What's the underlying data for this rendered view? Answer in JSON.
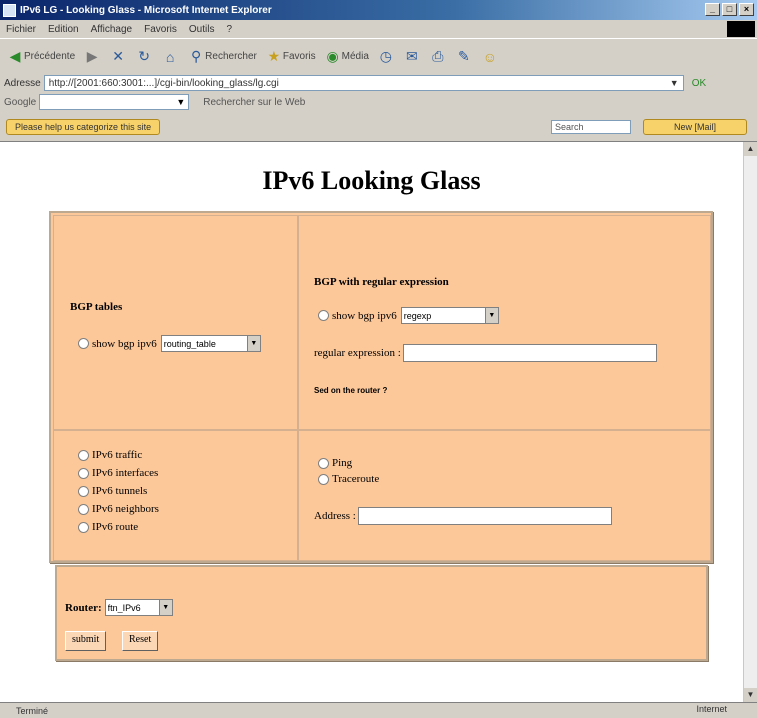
{
  "window": {
    "title": "IPv6 LG - Looking Glass - Microsoft Internet Explorer",
    "controls": [
      "_",
      "□",
      "×"
    ]
  },
  "menubar": {
    "items": [
      "Fichier",
      "Edition",
      "Affichage",
      "Favoris",
      "Outils",
      "?"
    ]
  },
  "toolbar": {
    "back": "Précédente",
    "search": "Rechercher",
    "favorites": "Favoris",
    "media": "Média"
  },
  "addressbar": {
    "label": "Adresse",
    "url": "http://[2001:660:3001:...]/cgi-bin/looking_glass/lg.cgi",
    "go": "OK"
  },
  "linksbar": {
    "label": "Google",
    "search_button": "Rechercher sur le Web"
  },
  "infobar": {
    "notice": "Please help us categorize this site",
    "search_placeholder": "Search",
    "newmail": "New [Mail]"
  },
  "page": {
    "title": "IPv6 Looking Glass",
    "bgp_tables": {
      "heading": "BGP tables",
      "option_label": "show bgp ipv6",
      "select_value": "routing_table"
    },
    "bgp_regex": {
      "heading": "BGP with regular expression",
      "option_label": "show bgp ipv6",
      "select_value": "regexp",
      "regex_label": "regular expression :",
      "regex_value": "",
      "help_link": "Sed on the router ?"
    },
    "commands": [
      "IPv6 traffic",
      "IPv6 interfaces",
      "IPv6 tunnels",
      "IPv6 neighbors",
      "IPv6 route"
    ],
    "tools": [
      "Ping",
      "Traceroute"
    ],
    "address_label": "Address :",
    "address_value": "",
    "router_label": "Router:",
    "router_value": "ftn_IPv6",
    "submit_label": "submit",
    "reset_label": "Reset"
  },
  "statusbar": {
    "status": "Terminé",
    "zone": "Internet"
  }
}
